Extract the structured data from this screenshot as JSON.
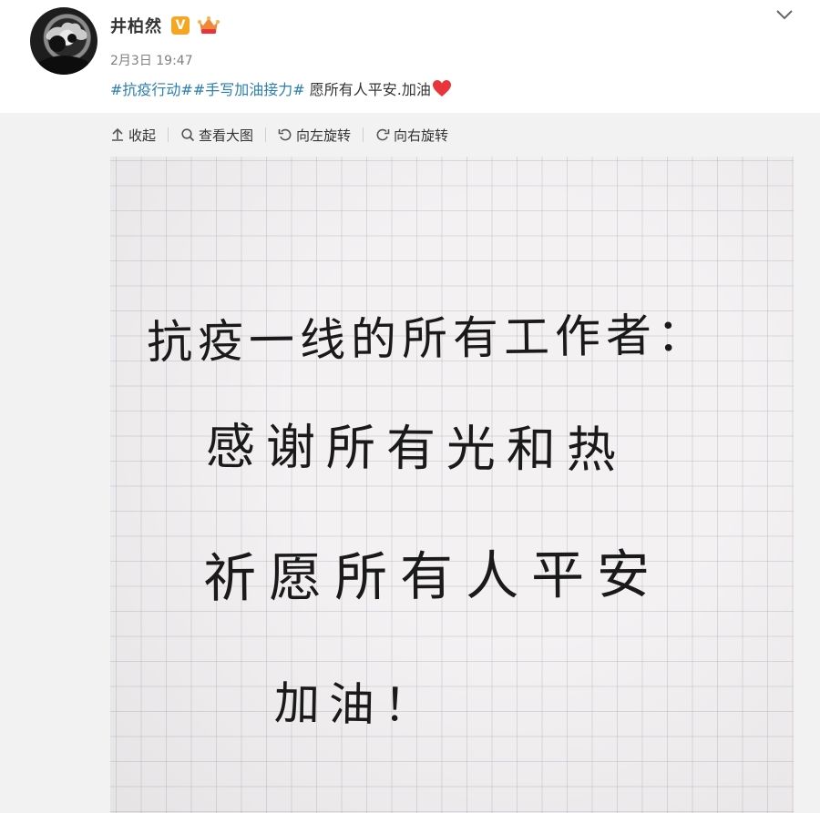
{
  "post": {
    "author": "井柏然",
    "timestamp": "2月3日 19:47",
    "badges": {
      "verified": "V"
    },
    "text": {
      "topic1": "#抗疫行动#",
      "topic2": "#手写加油接力#",
      "body": " 愿所有人平安.加油"
    },
    "toolbar": {
      "collapse": "收起",
      "view_large": "查看大图",
      "rotate_left": "向左旋转",
      "rotate_right": "向右旋转"
    },
    "image": {
      "line1": "抗疫一线的所有工作者：",
      "line2": "感谢所有光和热",
      "line3": "祈愿所有人平安",
      "line4": "加油！"
    },
    "icons": [
      "avatar",
      "vip-badge-icon",
      "crown-badge-icon",
      "chevron-down-icon",
      "heart-icon",
      "arrow-up-icon",
      "magnifier-icon",
      "rotate-left-icon",
      "rotate-right-icon"
    ],
    "colors": {
      "topic": "#2b7fb0",
      "vip": "#f5a623",
      "heart": "#e8343a",
      "media_bg": "#f2f2f2"
    }
  }
}
